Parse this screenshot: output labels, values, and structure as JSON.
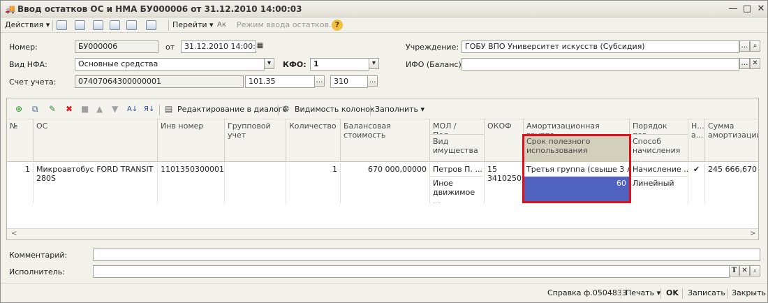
{
  "window": {
    "title": "Ввод остатков ОС и НМА БУ000006 от 31.12.2010 14:00:03",
    "btn_min": "—",
    "btn_max": "□",
    "btn_close": "✕"
  },
  "toolbar": {
    "actions": "Действия ▾",
    "goto": "Перейти ▾",
    "input_mode": "Режим ввода остатков...",
    "help": "?"
  },
  "form": {
    "number_label": "Номер:",
    "number_value": "БУ000006",
    "date_label": "от",
    "date_value": "31.12.2010 14:00:03",
    "institution_label": "Учреждение:",
    "institution_value": "ГОБУ ВПО Университет искусств (Субсидия)",
    "nfa_label": "Вид НФА:",
    "nfa_value": "Основные средства",
    "kfo_label": "КФО:",
    "kfo_value": "1",
    "ifo_label": "ИФО (Баланс):",
    "ifo_value": "",
    "account_label": "Счет учета:",
    "account_value": "07407064300000001",
    "account_part2": "101.35",
    "account_part3": "310"
  },
  "grid_toolbar": {
    "edit_dialog": "Редактирование в диалоге",
    "columns": "Видимость колонок",
    "fill": "Заполнить ▾"
  },
  "columns": {
    "n": "№",
    "os": "ОС",
    "inv": "Инв номер",
    "group_acc": "Групповой учет",
    "qty": "Количество",
    "balance": "Балансовая стоимость",
    "mol": "МОЛ / Под...",
    "property_type": "Вид имущества",
    "okof": "ОКОФ",
    "amort_group": "Амортизационная группа",
    "useful_life": "Срок полезного использования",
    "order": "Порядок пог...",
    "method": "Способ начисления ...",
    "flag": "Н... а...",
    "amort_sum": "Сумма амортизации"
  },
  "rows": [
    {
      "n": "1",
      "os": "Микроавтобус FORD TRANSIT 280S",
      "inv": "1101350300001",
      "group_acc": "",
      "qty": "1",
      "balance": "670 000,00000",
      "mol": "Петров П. ...",
      "property_type": "Иное движимое ...",
      "okof": "15 3410250",
      "amort_group": "Третья группа (свыше 3 л...",
      "useful_life": "60",
      "order": "Начисление ...",
      "method": "Линейный",
      "flag": "✔",
      "amort_sum": "245 666,670"
    }
  ],
  "footer": {
    "comment_label": "Комментарий:",
    "comment_value": "",
    "executor_label": "Исполнитель:",
    "executor_value": "",
    "t_btn": "T",
    "x_btn": "✕",
    "q_btn": "🔍"
  },
  "statusbar": {
    "report": "Справка ф.0504833",
    "print": "Печать ▾",
    "ok": "OK",
    "save": "Записать",
    "close": "Закрыть"
  },
  "colors": {
    "selected_cell": "#4f62bf",
    "highlight_border": "#e0101a"
  }
}
